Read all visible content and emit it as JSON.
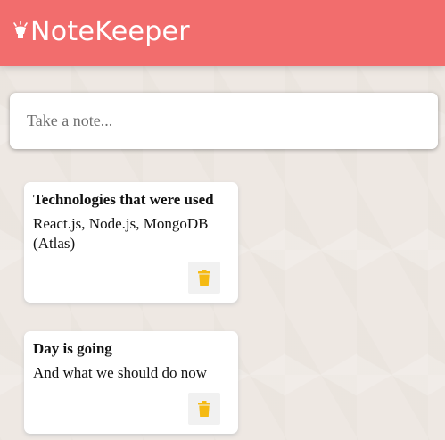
{
  "header": {
    "title": "NoteKeeper",
    "logo_icon": "lightbulb-icon",
    "background_color": "#f26d6d",
    "text_color": "#ffffff"
  },
  "create_area": {
    "placeholder": "Take a note..."
  },
  "notes": [
    {
      "title": "Technologies that were used",
      "content": "React.js, Node.js, MongoDB (Atlas)",
      "delete_icon": "trash-icon"
    },
    {
      "title": "Day is going",
      "content": "And what we should do now",
      "delete_icon": "trash-icon"
    }
  ],
  "colors": {
    "accent": "#f5ba13",
    "page_background": "#eee8e3"
  }
}
